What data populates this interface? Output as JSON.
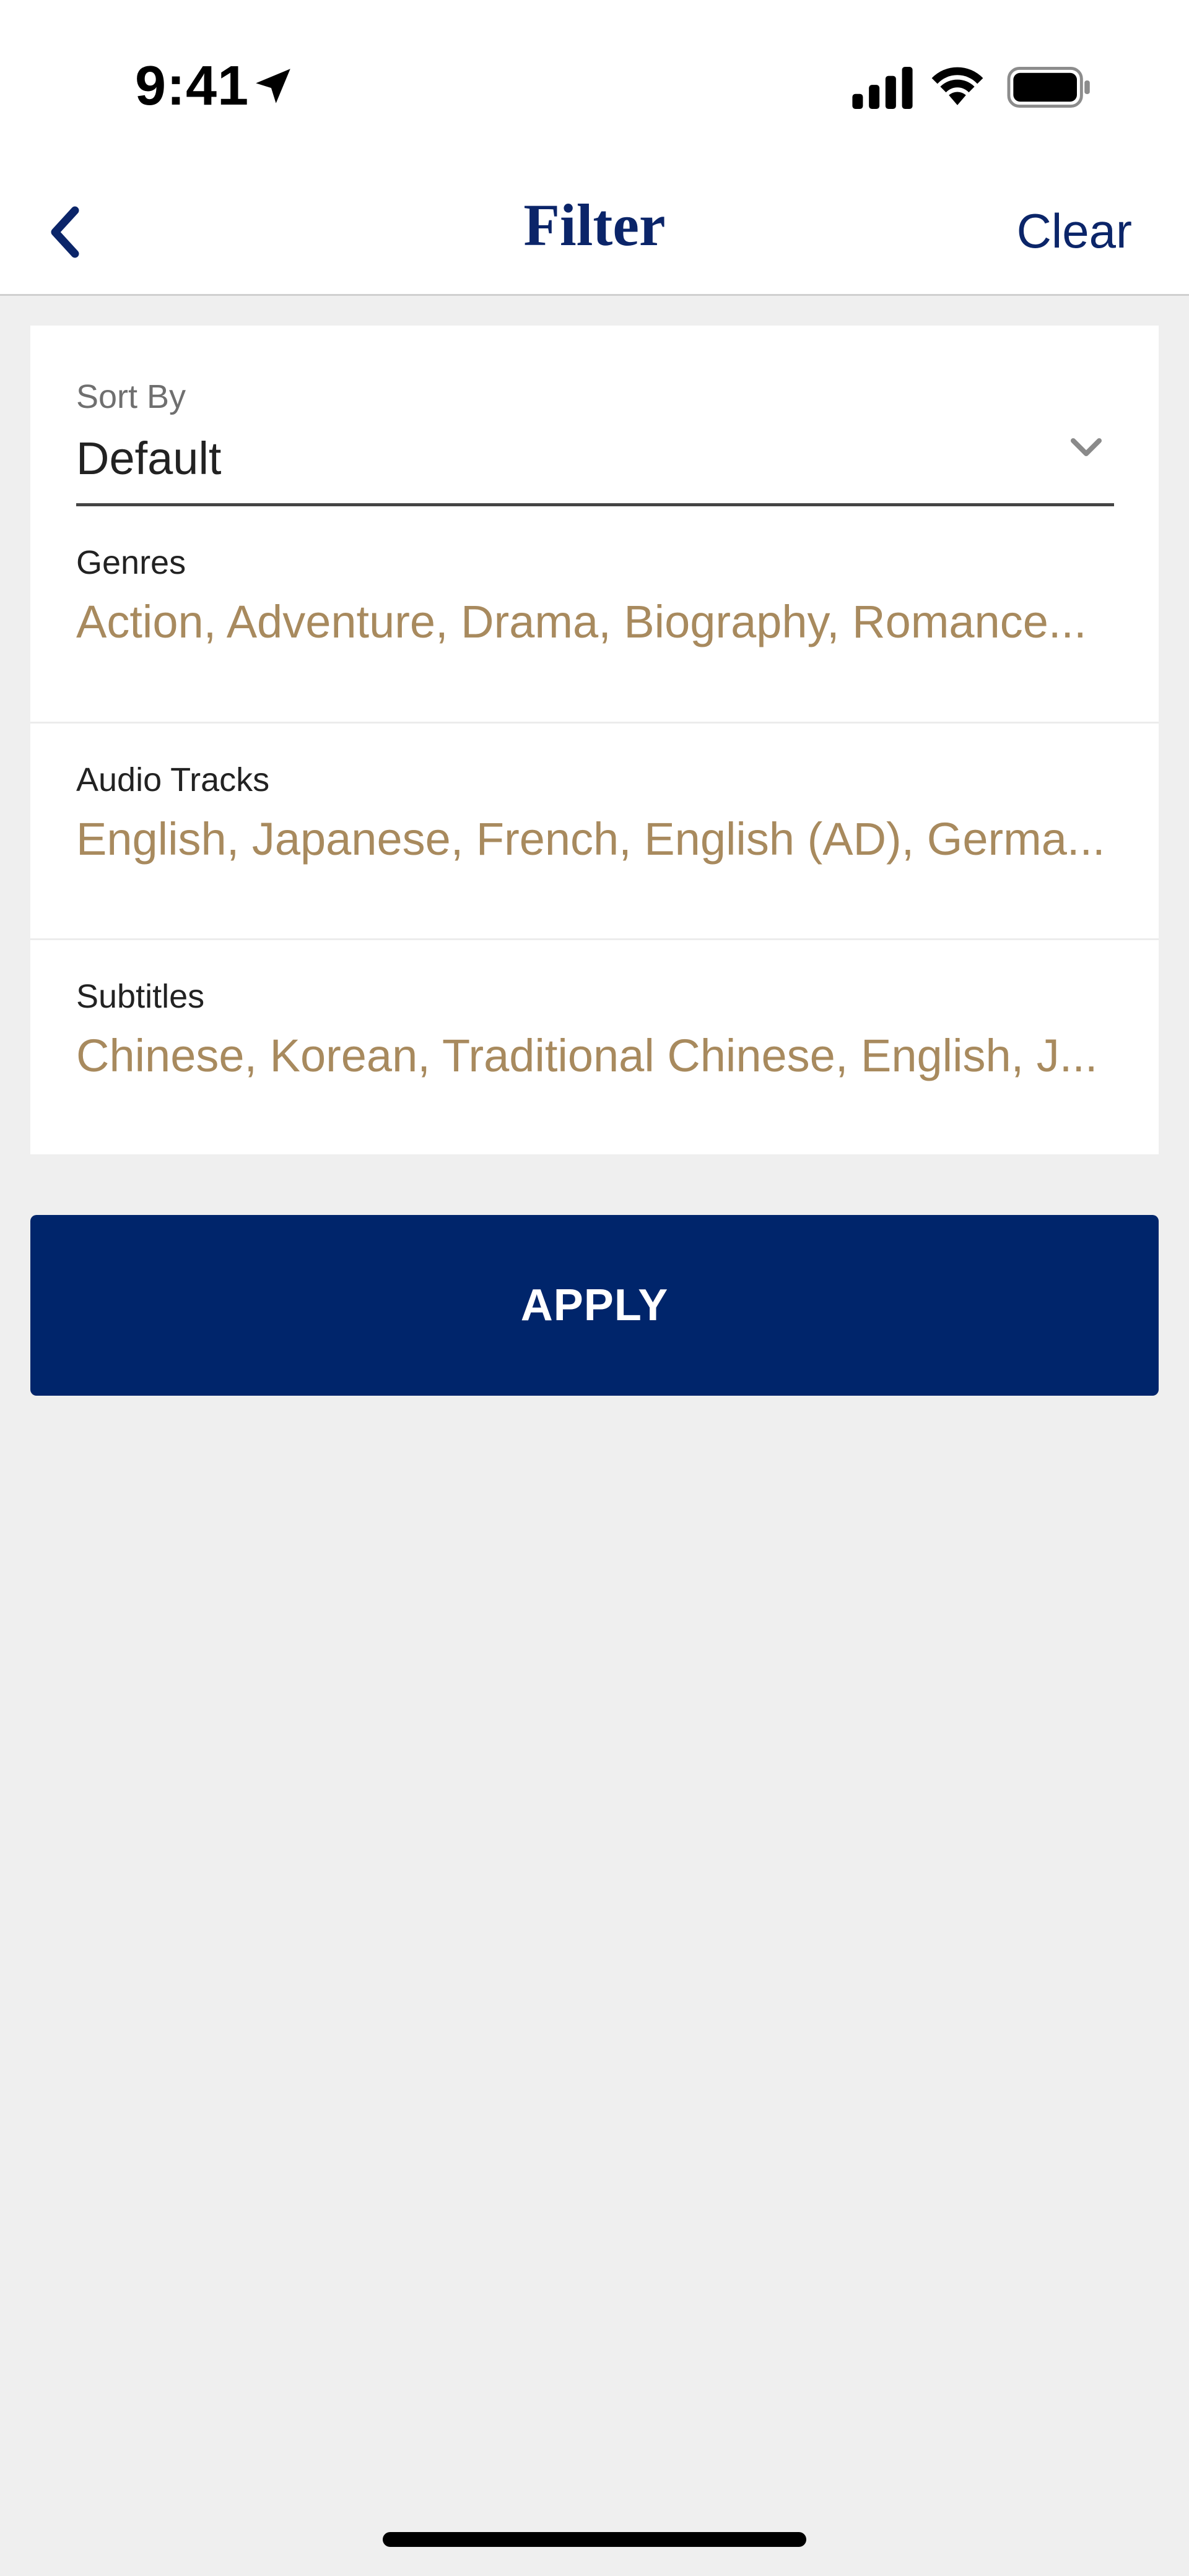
{
  "status_bar": {
    "time": "9:41",
    "icons": [
      "location-arrow-icon",
      "cellular-signal-icon",
      "wifi-icon",
      "battery-icon"
    ]
  },
  "nav": {
    "title": "Filter",
    "clear_label": "Clear",
    "back_icon": "chevron-left-icon"
  },
  "sort": {
    "label": "Sort By",
    "value": "Default",
    "icon": "chevron-down-icon"
  },
  "filters": [
    {
      "label": "Genres",
      "value": "Action, Adventure, Drama, Biography, Romance..."
    },
    {
      "label": "Audio Tracks",
      "value": "English, Japanese, French, English (AD), Germa..."
    },
    {
      "label": "Subtitles",
      "value": "Chinese, Korean, Traditional Chinese, English, J..."
    }
  ],
  "apply_label": "APPLY",
  "colors": {
    "brand_navy": "#00256B",
    "title_navy": "#0B2569",
    "value_gold": "#A88A5E",
    "background": "#EFEFEF"
  }
}
